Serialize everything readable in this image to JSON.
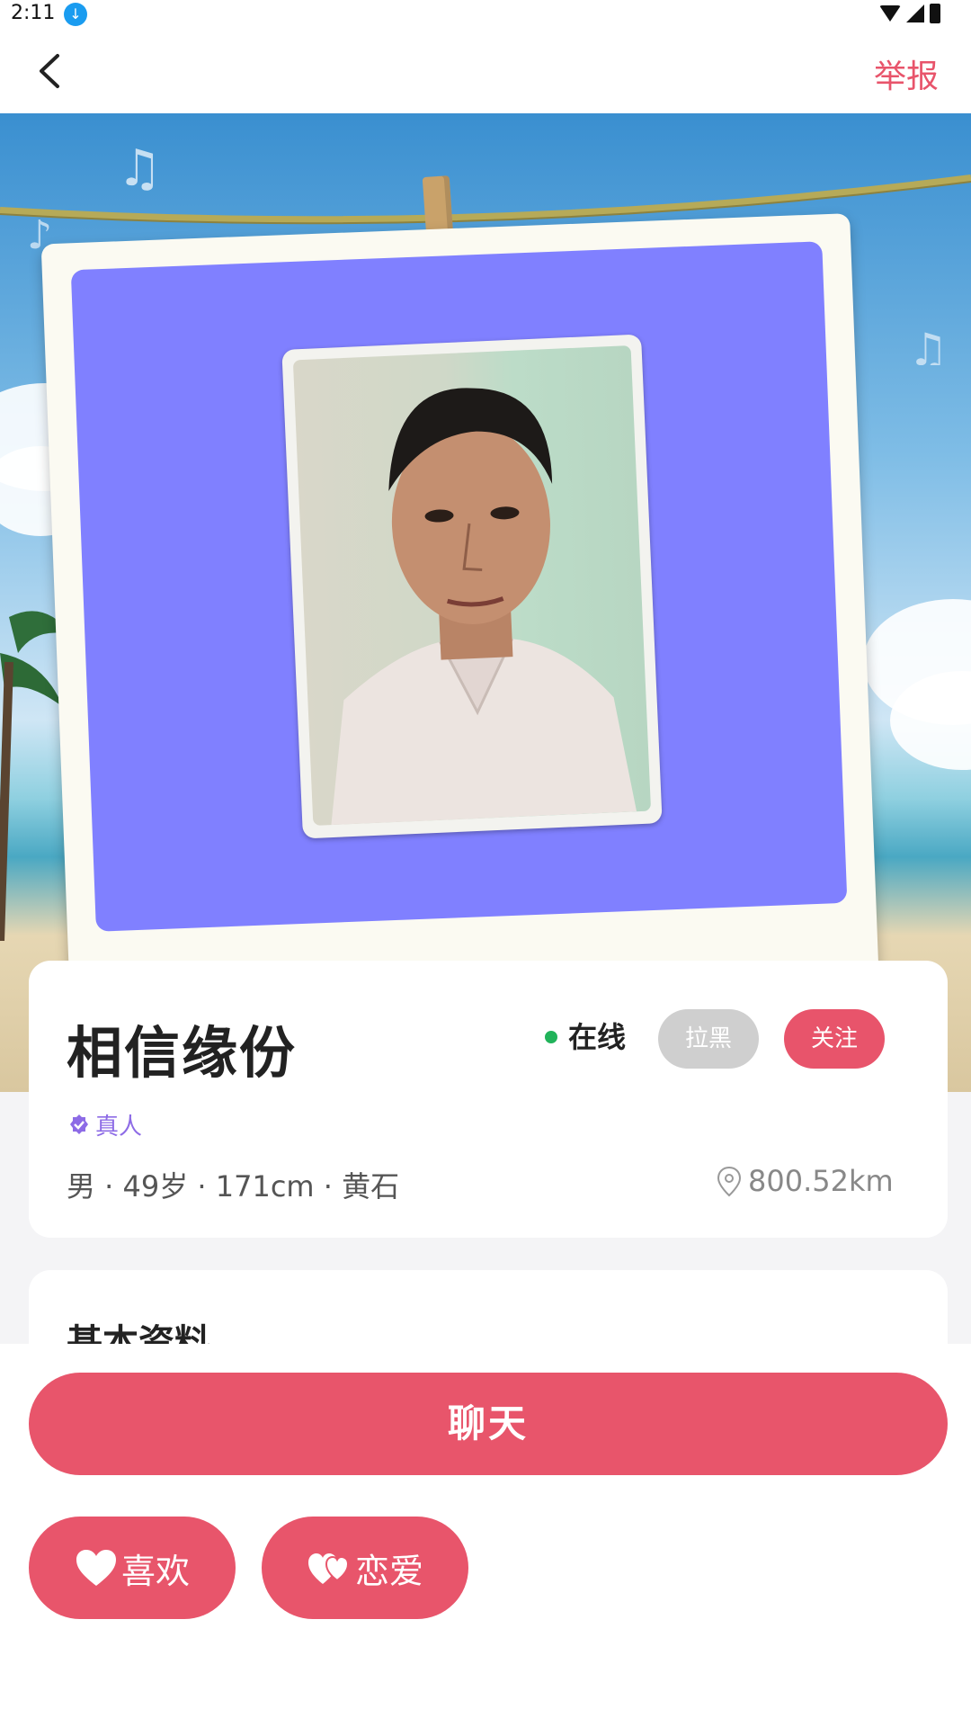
{
  "status_bar": {
    "time": "2:11"
  },
  "nav": {
    "report_label": "举报"
  },
  "profile": {
    "name": "相信缘份",
    "online_label": "在线",
    "block_label": "拉黑",
    "follow_label": "关注",
    "verified_label": "真人",
    "info_line": "男 · 49岁 · 171cm · 黄石",
    "distance": "800.52km"
  },
  "basic_info": {
    "title": "基本资料"
  },
  "actions": {
    "chat_label": "聊天",
    "like_label": "喜欢",
    "love_label": "恋爱"
  },
  "colors": {
    "accent": "#e8556b",
    "online": "#21b35a",
    "verified": "#8d6be6",
    "photo_background": "#8080ff"
  }
}
